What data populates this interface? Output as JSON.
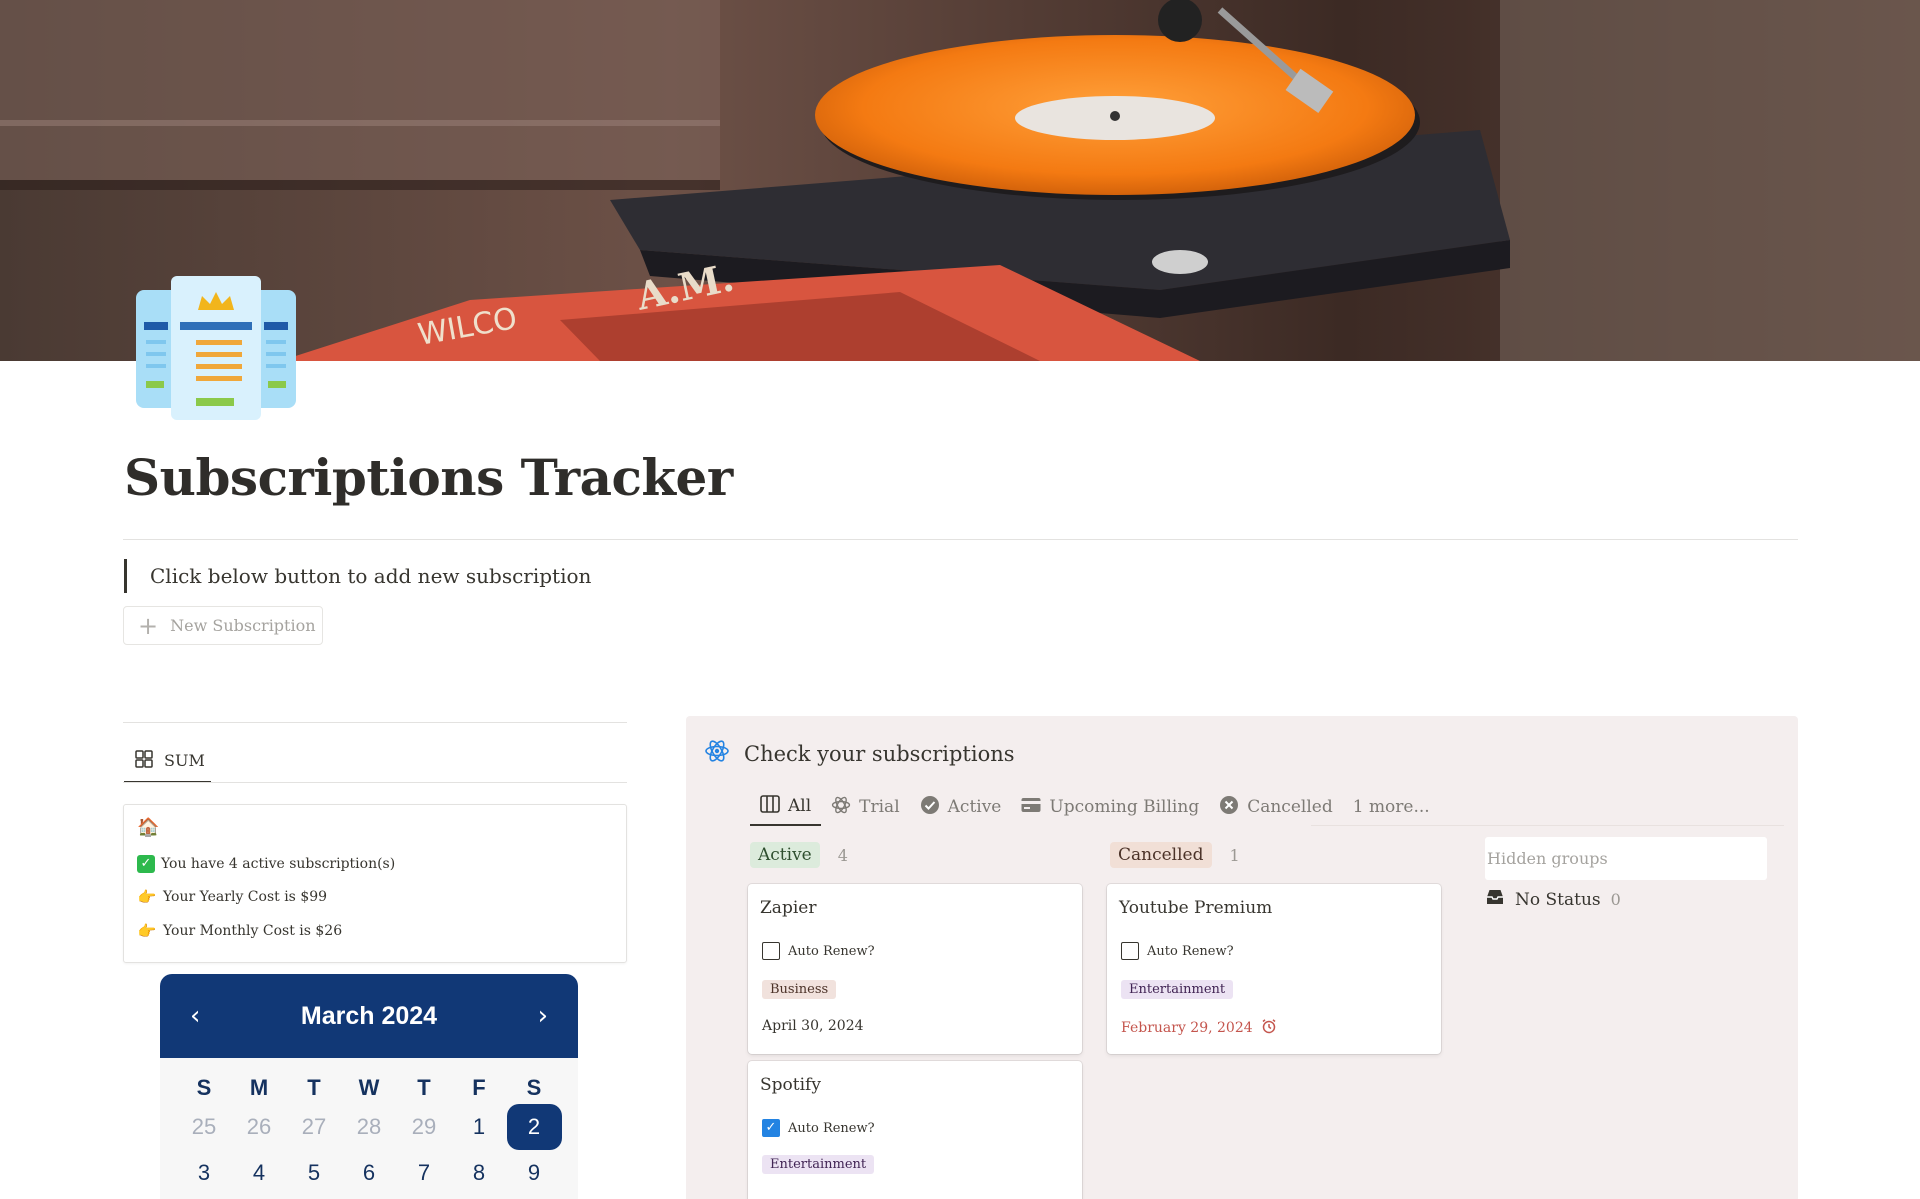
{
  "page": {
    "title": "Subscriptions Tracker",
    "callout": "Click below button to add new subscription",
    "new_button": "New Subscription"
  },
  "summary": {
    "tab_label": "SUM",
    "lines": [
      "You have 4 active subscription(s)",
      "Your Yearly Cost is $99",
      "Your Monthly Cost is $26"
    ]
  },
  "calendar": {
    "month": "March 2024",
    "weekdays": [
      "S",
      "M",
      "T",
      "W",
      "T",
      "F",
      "S"
    ],
    "rows": [
      [
        "25",
        "26",
        "27",
        "28",
        "29",
        "1",
        "2"
      ],
      [
        "3",
        "4",
        "5",
        "6",
        "7",
        "8",
        "9"
      ]
    ],
    "today": "2",
    "colors": {
      "header": "#113876",
      "muted": "#a9afbb"
    }
  },
  "board": {
    "title": "Check your subscriptions",
    "tabs": [
      "All",
      "Trial",
      "Active",
      "Upcoming Billing",
      "Cancelled",
      "1 more..."
    ],
    "groups": [
      {
        "label": "Active",
        "count": "4"
      },
      {
        "label": "Cancelled",
        "count": "1"
      }
    ],
    "cards": [
      {
        "name": "Zapier",
        "renew_label": "Auto Renew?",
        "renew": false,
        "tag": "Business",
        "date": "April 30, 2024"
      },
      {
        "name": "Spotify",
        "renew_label": "Auto Renew?",
        "renew": true,
        "tag": "Entertainment",
        "date": ""
      },
      {
        "name": "Youtube Premium",
        "renew_label": "Auto Renew?",
        "renew": false,
        "tag": "Entertainment",
        "date": "February 29, 2024"
      }
    ],
    "hidden_groups": "Hidden groups",
    "no_status": {
      "label": "No Status",
      "count": "0"
    }
  }
}
